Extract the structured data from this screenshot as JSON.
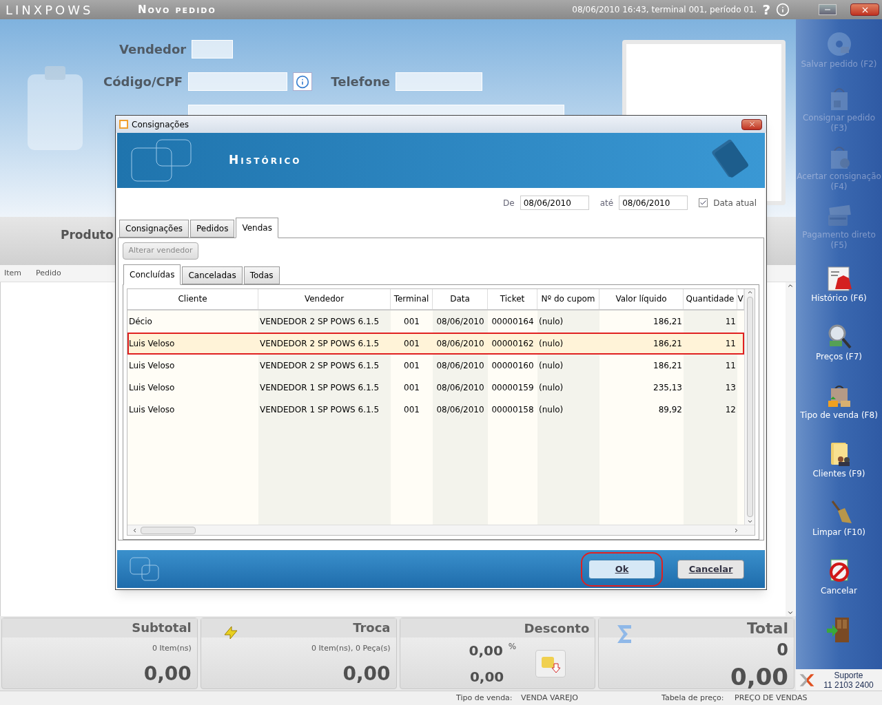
{
  "app": {
    "logo": "LINXPOWS",
    "title": "Novo pedido",
    "status": "08/06/2010 16:43, terminal 001, período 01.",
    "help": "?"
  },
  "form": {
    "fields": [
      {
        "label": "Vendedor"
      },
      {
        "label": "Código/CPF"
      },
      {
        "label": "Telefone"
      }
    ]
  },
  "product": {
    "label": "Produto",
    "columns": [
      "Item",
      "Pedido"
    ]
  },
  "totals": [
    {
      "kind": "subtotal",
      "title": "Subtotal",
      "detail": "0 Item(ns)",
      "value": "0,00"
    },
    {
      "kind": "troca",
      "title": "Troca",
      "detail": "0 Item(ns), 0 Peça(s)",
      "value": "0,00"
    },
    {
      "kind": "desconto",
      "title": "Desconto",
      "percent": "0,00",
      "unit": "%",
      "value": "0,00"
    },
    {
      "kind": "total",
      "title": "Total",
      "count": "0",
      "value": "0,00"
    }
  ],
  "status_bar": [
    {
      "label": "Tipo de venda:",
      "value": "VENDA VAREJO"
    },
    {
      "label": "Tabela de preço:",
      "value": "PREÇO DE VENDAS"
    }
  ],
  "sidebar": {
    "items": [
      {
        "label": "Salvar pedido (F2)",
        "disabled": true
      },
      {
        "label": "Consignar pedido (F3)",
        "disabled": true
      },
      {
        "label": "Acertar consignação (F4)",
        "disabled": true
      },
      {
        "label": "Pagamento direto (F5)",
        "disabled": true
      },
      {
        "label": "Histórico (F6)",
        "disabled": false
      },
      {
        "label": "Preços (F7)",
        "disabled": false
      },
      {
        "label": "Tipo de venda (F8)",
        "disabled": false
      },
      {
        "label": "Clientes (F9)",
        "disabled": false
      },
      {
        "label": "Limpar (F10)",
        "disabled": false
      },
      {
        "label": "Cancelar",
        "disabled": false
      }
    ],
    "support": {
      "label": "Suporte",
      "phone": "11 2103 2400"
    }
  },
  "dialog": {
    "title": "Consignações",
    "banner": "Histórico",
    "date_filter": {
      "from_label": "De",
      "from": "08/06/2010",
      "to_label": "até",
      "to": "08/06/2010",
      "current_label": "Data atual",
      "current_date": true
    },
    "tabs": [
      {
        "label": "Consignações",
        "selected": false
      },
      {
        "label": "Pedidos",
        "selected": false
      },
      {
        "label": "Vendas",
        "selected": true
      }
    ],
    "action": {
      "label": "Alterar vendedor",
      "disabled": true
    },
    "subtabs": [
      {
        "label": "Concluídas",
        "selected": true
      },
      {
        "label": "Canceladas",
        "selected": false
      },
      {
        "label": "Todas",
        "selected": false
      }
    ],
    "table": {
      "columns": [
        "Cliente",
        "Vendedor",
        "Terminal",
        "Data",
        "Ticket",
        "Nº do cupom",
        "Valor líquido",
        "Quantidade",
        "V"
      ],
      "rows": [
        {
          "cells": [
            "Décio",
            "VENDEDOR 2 SP POWS 6.1.5",
            "001",
            "08/06/2010",
            "00000164",
            "(nulo)",
            "186,21",
            "11"
          ],
          "selected": false
        },
        {
          "cells": [
            "Luis Veloso",
            "VENDEDOR 2 SP POWS 6.1.5",
            "001",
            "08/06/2010",
            "00000162",
            "(nulo)",
            "186,21",
            "11"
          ],
          "selected": true
        },
        {
          "cells": [
            "Luis Veloso",
            "VENDEDOR 2 SP POWS 6.1.5",
            "001",
            "08/06/2010",
            "00000160",
            "(nulo)",
            "186,21",
            "11"
          ],
          "selected": false
        },
        {
          "cells": [
            "Luis Veloso",
            "VENDEDOR 1 SP POWS 6.1.5",
            "001",
            "08/06/2010",
            "00000159",
            "(nulo)",
            "235,13",
            "13"
          ],
          "selected": false
        },
        {
          "cells": [
            "Luis Veloso",
            "VENDEDOR 1 SP POWS 6.1.5",
            "001",
            "08/06/2010",
            "00000158",
            "(nulo)",
            "89,92",
            "12"
          ],
          "selected": false
        }
      ]
    },
    "buttons": [
      {
        "label": "Ok",
        "focused": true
      },
      {
        "label": "Cancelar",
        "focused": false
      }
    ]
  }
}
